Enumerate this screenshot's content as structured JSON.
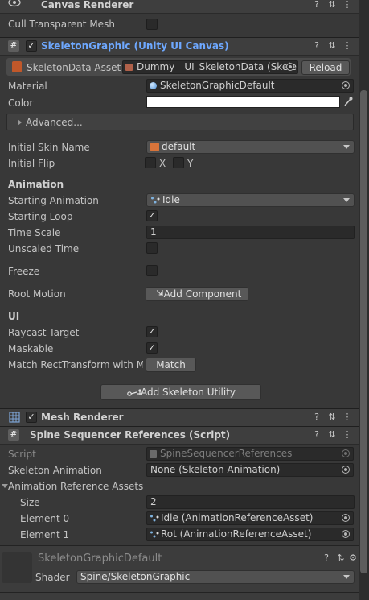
{
  "canvas_renderer": {
    "title": "Canvas Renderer",
    "cull_label": "Cull Transparent Mesh"
  },
  "skeleton_graphic": {
    "title": "SkeletonGraphic (Unity UI Canvas)",
    "data_asset_label": "SkeletonData Asset",
    "data_asset_value": "Dummy__UI_SkeletonData (Skele",
    "reload_label": "Reload",
    "material_label": "Material",
    "material_value": "SkeletonGraphicDefault",
    "color_label": "Color",
    "advanced_label": "Advanced...",
    "skin_label": "Initial Skin Name",
    "skin_value": "default",
    "flip_label": "Initial Flip",
    "flip_x": "X",
    "flip_y": "Y",
    "animation_header": "Animation",
    "starting_animation_label": "Starting Animation",
    "starting_animation_value": "Idle",
    "starting_loop_label": "Starting Loop",
    "time_scale_label": "Time Scale",
    "time_scale_value": "1",
    "unscaled_time_label": "Unscaled Time",
    "freeze_label": "Freeze",
    "root_motion_label": "Root Motion",
    "add_component_label": "Add Component",
    "ui_header": "UI",
    "raycast_label": "Raycast Target",
    "maskable_label": "Maskable",
    "match_rect_label": "Match RectTransform with Me",
    "match_button_label": "Match",
    "add_utility_label": "Add Skeleton Utility"
  },
  "mesh_renderer": {
    "title": "Mesh Renderer"
  },
  "spine_sequencer": {
    "title": "Spine Sequencer References (Script)",
    "script_label": "Script",
    "script_value": "SpineSequencerReferences",
    "skeleton_anim_label": "Skeleton Animation",
    "skeleton_anim_value": "None (Skeleton Animation)",
    "assets_label": "Animation Reference Assets",
    "size_label": "Size",
    "size_value": "2",
    "element0_label": "Element 0",
    "element0_value": "Idle (AnimationReferenceAsset)",
    "element1_label": "Element 1",
    "element1_value": "Rot (AnimationReferenceAsset)"
  },
  "material_preview": {
    "name": "SkeletonGraphicDefault",
    "shader_label": "Shader",
    "shader_value": "Spine/SkeletonGraphic"
  },
  "colors": {
    "background": "#383838",
    "header": "#3e3e3e",
    "field": "#2a2a2a",
    "accent_blue": "#6ea8ff"
  }
}
